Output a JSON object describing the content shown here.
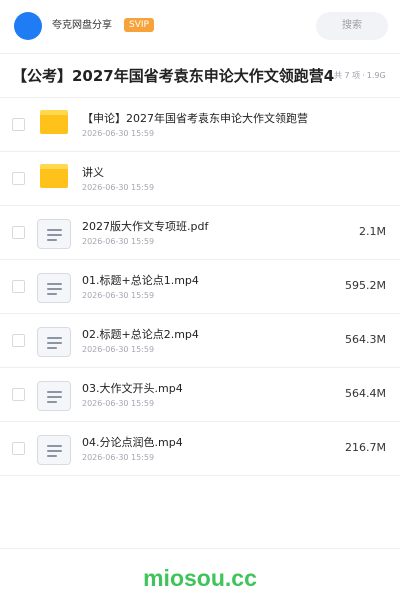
{
  "header": {
    "nickname": "夸克网盘分享",
    "badge": "SVIP",
    "search_label": "搜索"
  },
  "share": {
    "title": "【公考】2027年国省考袁东申论大作文领跑营4",
    "count_text": "共 7 项",
    "separator": "·",
    "total_size": "1.9G"
  },
  "files": [
    {
      "type": "folder",
      "icon": "folder-icon",
      "name": "【申论】2027年国省考袁东申论大作文领跑营",
      "date": "2026-06-30 15:59",
      "size": ""
    },
    {
      "type": "folder",
      "icon": "folder-icon",
      "name": "讲义",
      "date": "2026-06-30 15:59",
      "size": ""
    },
    {
      "type": "file",
      "icon": "document-icon",
      "name": "2027版大作文专项班.pdf",
      "date": "2026-06-30 15:59",
      "size": "2.1M"
    },
    {
      "type": "file",
      "icon": "document-icon",
      "name": "01.标题+总论点1.mp4",
      "date": "2026-06-30 15:59",
      "size": "595.2M"
    },
    {
      "type": "file",
      "icon": "document-icon",
      "name": "02.标题+总论点2.mp4",
      "date": "2026-06-30 15:59",
      "size": "564.3M"
    },
    {
      "type": "file",
      "icon": "document-icon",
      "name": "03.大作文开头.mp4",
      "date": "2026-06-30 15:59",
      "size": "564.4M"
    },
    {
      "type": "file",
      "icon": "document-icon",
      "name": "04.分论点润色.mp4",
      "date": "2026-06-30 15:59",
      "size": "216.7M"
    }
  ],
  "footer": {
    "watermark": "miosou.cc"
  },
  "colors": {
    "avatar": "#1f7cf5",
    "badge": "#f7a23b",
    "folder": "#ffc21a",
    "watermark": "#3ec45a"
  }
}
